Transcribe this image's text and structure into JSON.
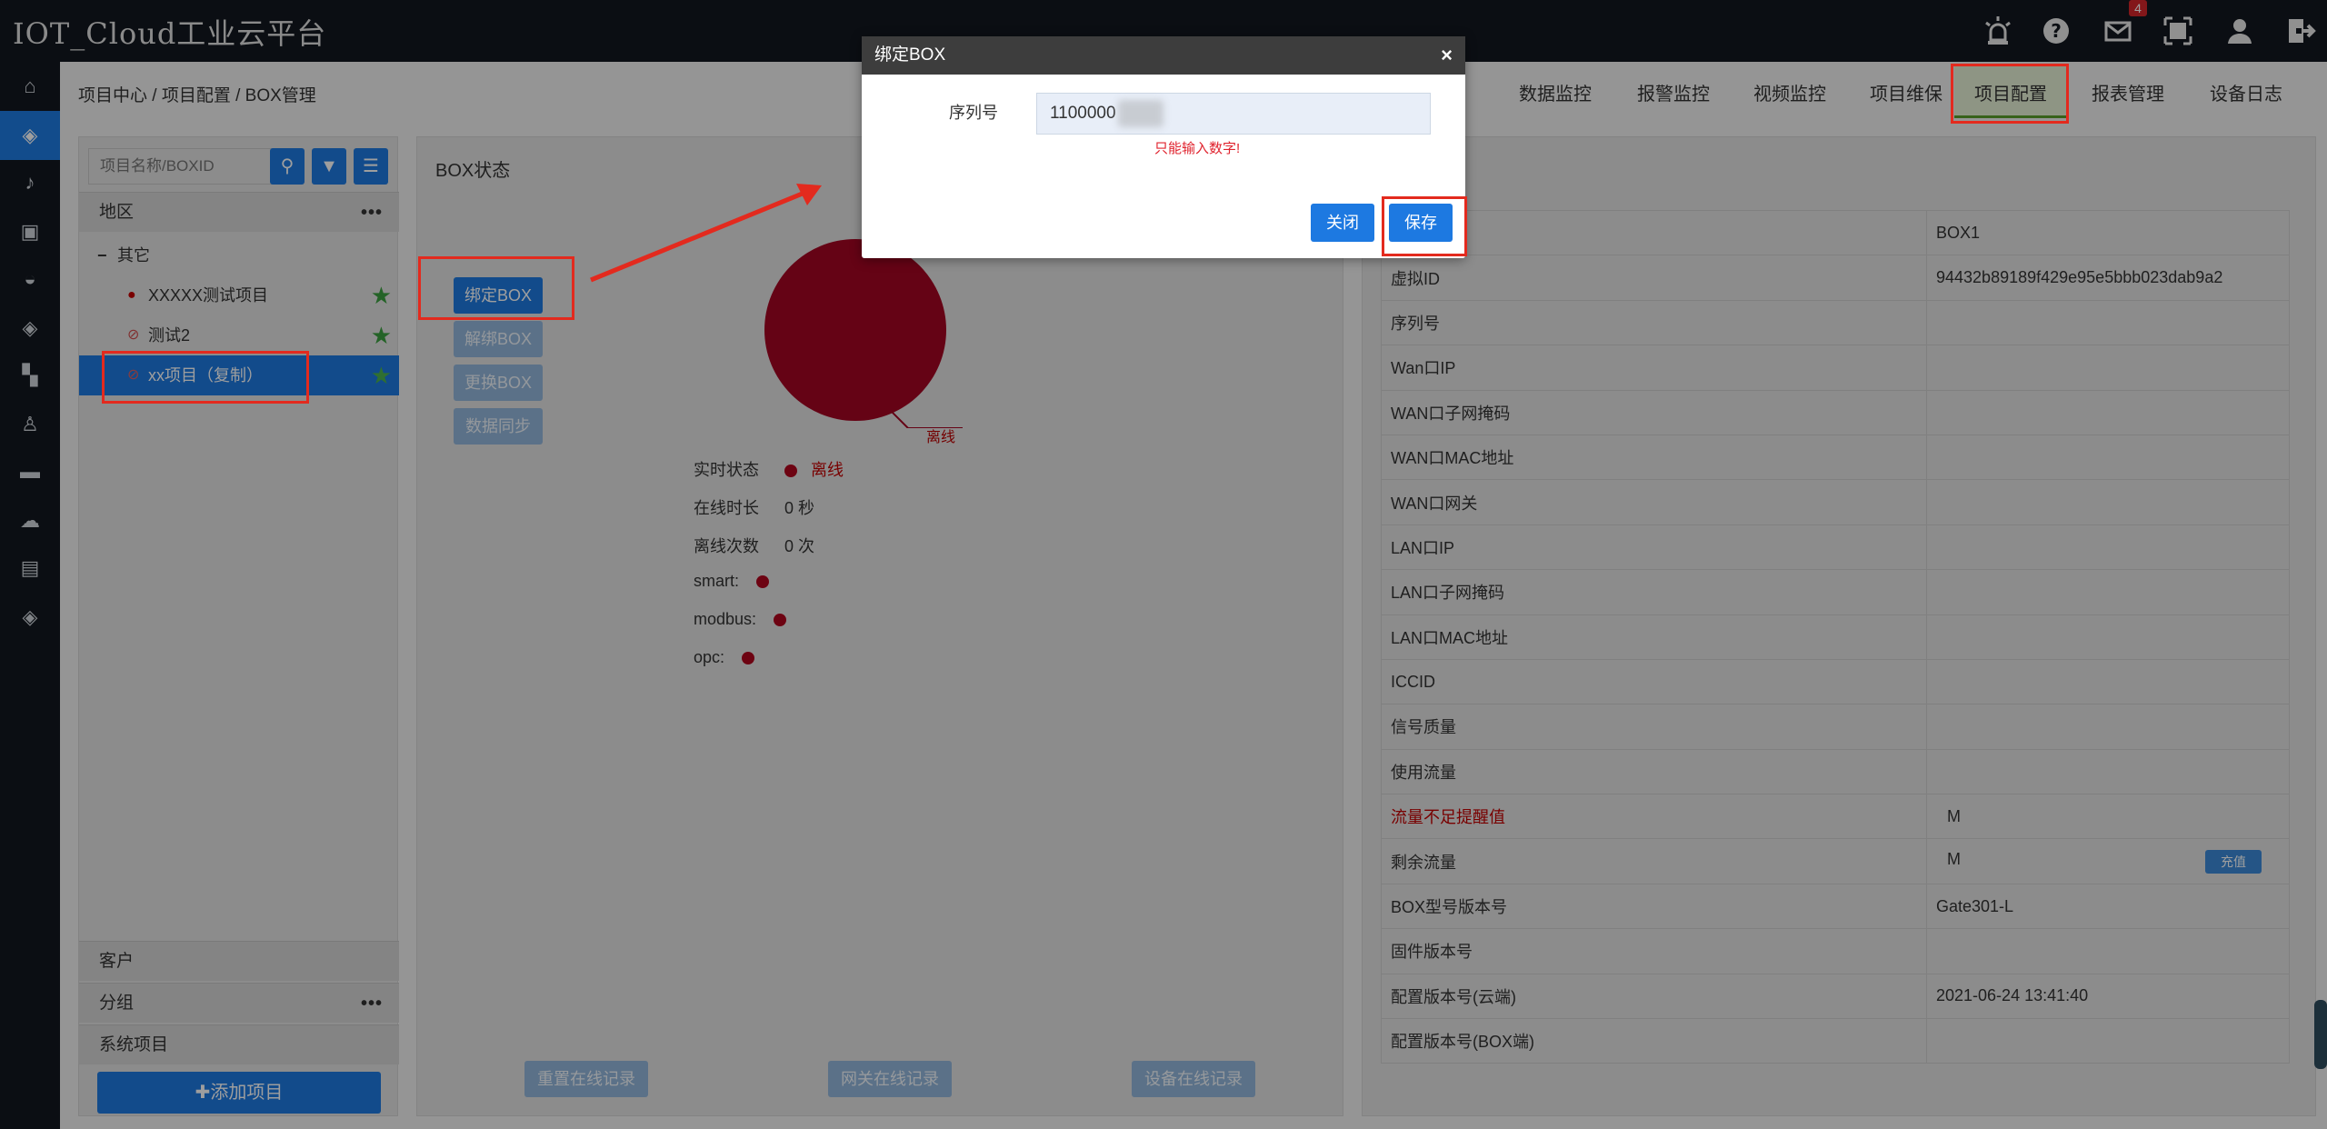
{
  "app": {
    "title": "IOT_Cloud工业云平台",
    "notification_count": "4"
  },
  "topbar_icons": [
    "alarm-light-icon",
    "help-icon",
    "mail-icon",
    "fullscreen-icon",
    "user-icon",
    "logout-icon"
  ],
  "left_nav": [
    "home-icon",
    "layers-icon",
    "bell-icon",
    "layout-icon",
    "dashboard-icon",
    "layers-icon",
    "apps-icon",
    "user-badge-icon",
    "car-icon",
    "cloud-icon",
    "document-icon",
    "layers-icon"
  ],
  "breadcrumb": "项目中心 / 项目配置 / BOX管理",
  "main_tabs": [
    {
      "label": "数据监控"
    },
    {
      "label": "报警监控"
    },
    {
      "label": "视频监控"
    },
    {
      "label": "项目维保"
    },
    {
      "label": "项目配置"
    },
    {
      "label": "报表管理"
    },
    {
      "label": "设备日志"
    }
  ],
  "sidebar": {
    "search_placeholder": "项目名称/BOXID",
    "region_header": "地区",
    "group_other": "其它",
    "projects": [
      {
        "name": "XXXXX测试项目"
      },
      {
        "name": "测试2"
      },
      {
        "name": "xx项目（复制）"
      }
    ],
    "customer": "客户",
    "group": "分组",
    "system_projects": "系统项目",
    "add_project": "✚添加项目",
    "more": "•••"
  },
  "box_status": {
    "title": "BOX状态",
    "actions": [
      "绑定BOX",
      "解绑BOX",
      "更换BOX",
      "数据同步"
    ],
    "pie_label": "离线",
    "stats": [
      {
        "label": "实时状态",
        "value": "离线"
      },
      {
        "label": "在线时长",
        "value": "0 秒"
      },
      {
        "label": "离线次数",
        "value": "0 次"
      },
      {
        "label": "smart:",
        "value": ""
      },
      {
        "label": "modbus:",
        "value": ""
      },
      {
        "label": "opc:",
        "value": ""
      }
    ],
    "bottom_buttons": [
      "重置在线记录",
      "网关在线记录",
      "设备在线记录"
    ]
  },
  "box_info": [
    {
      "key": "",
      "value": "BOX1"
    },
    {
      "key": "虚拟ID",
      "value": "94432b89189f429e95e5bbb023dab9a2"
    },
    {
      "key": "序列号",
      "value": ""
    },
    {
      "key": "Wan口IP",
      "value": ""
    },
    {
      "key": "WAN口子网掩码",
      "value": ""
    },
    {
      "key": "WAN口MAC地址",
      "value": ""
    },
    {
      "key": "WAN口网关",
      "value": ""
    },
    {
      "key": "LAN口IP",
      "value": ""
    },
    {
      "key": "LAN口子网掩码",
      "value": ""
    },
    {
      "key": "LAN口MAC地址",
      "value": ""
    },
    {
      "key": "ICCID",
      "value": ""
    },
    {
      "key": "信号质量",
      "value": ""
    },
    {
      "key": "使用流量",
      "value": ""
    },
    {
      "key": "流量不足提醒值",
      "value": "M"
    },
    {
      "key": "剩余流量",
      "value": "M",
      "button": "充值"
    },
    {
      "key": "BOX型号版本号",
      "value": "Gate301-L"
    },
    {
      "key": "固件版本号",
      "value": ""
    },
    {
      "key": "配置版本号(云端)",
      "value": "2021-06-24 13:41:40"
    },
    {
      "key": "配置版本号(BOX端)",
      "value": ""
    }
  ],
  "modal": {
    "title": "绑定BOX",
    "close_icon": "×",
    "serial_label": "序列号",
    "serial_value": "1100000",
    "hint": "只能输入数字!",
    "btn_close": "关闭",
    "btn_save": "保存"
  },
  "colors": {
    "accent": "#1d79e1",
    "offline": "#a30622",
    "annotation": "#e32a1e",
    "topbar": "#131820"
  }
}
